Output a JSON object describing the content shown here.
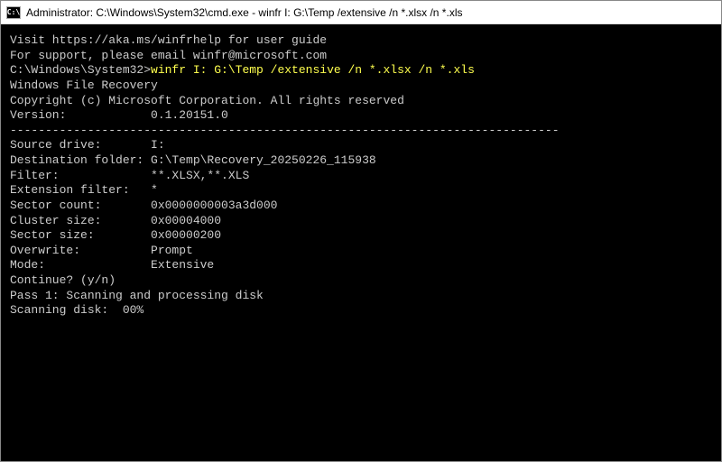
{
  "titlebar": {
    "title": "Administrator: C:\\Windows\\System32\\cmd.exe - winfr  I: G:\\Temp /extensive /n *.xlsx /n *.xls"
  },
  "terminal": {
    "blank0": "",
    "guide1": "Visit https://aka.ms/winfrhelp for user guide",
    "guide2": "For support, please email winfr@microsoft.com",
    "blank1": "",
    "prompt_prefix": "C:\\Windows\\System32>",
    "command": "winfr I: G:\\Temp /extensive /n *.xlsx /n *.xls",
    "blank2": "",
    "app_name": "Windows File Recovery",
    "copyright": "Copyright (c) Microsoft Corporation. All rights reserved",
    "version_line": "Version:            0.1.20151.0",
    "separator": "------------------------------------------------------------------------------",
    "blank3": "",
    "source_drive": "Source drive:       I:",
    "dest_folder": "Destination folder: G:\\Temp\\Recovery_20250226_115938",
    "filter": "Filter:             **.XLSX,**.XLS",
    "ext_filter": "Extension filter:   *",
    "blank4": "",
    "sector_count": "Sector count:       0x0000000003a3d000",
    "cluster_size": "Cluster size:       0x00004000",
    "sector_size": "Sector size:        0x00000200",
    "overwrite": "Overwrite:          Prompt",
    "mode": "Mode:               Extensive",
    "blank5": "",
    "blank6": "",
    "continue": "Continue? (y/n)",
    "pass1": "Pass 1: Scanning and processing disk",
    "scanning": "Scanning disk:  00%"
  }
}
